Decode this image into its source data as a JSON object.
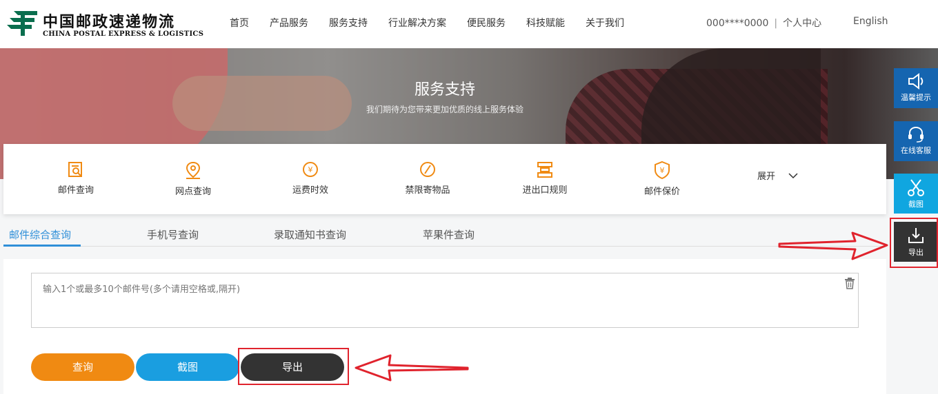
{
  "header": {
    "logo_cn": "中国邮政速递物流",
    "logo_en": "CHINA POSTAL EXPRESS & LOGISTICS",
    "nav": [
      "首页",
      "产品服务",
      "服务支持",
      "行业解决方案",
      "便民服务",
      "科技赋能",
      "关于我们"
    ],
    "account_phone": "000****0000",
    "account_sep": "|",
    "account_center": "个人中心",
    "language": "English"
  },
  "banner": {
    "title": "服务支持",
    "subtitle": "我们期待为您带来更加优质的线上服务体验"
  },
  "quick_services": {
    "items": [
      {
        "label": "邮件查询",
        "icon": "mail-search-icon"
      },
      {
        "label": "网点查询",
        "icon": "location-pin-icon"
      },
      {
        "label": "运费时效",
        "icon": "yuan-clock-icon"
      },
      {
        "label": "禁限寄物品",
        "icon": "forbidden-icon"
      },
      {
        "label": "进出口规则",
        "icon": "customs-rules-icon"
      },
      {
        "label": "邮件保价",
        "icon": "yuan-shield-icon"
      }
    ],
    "expand_label": "展开"
  },
  "tabs": [
    "邮件综合查询",
    "手机号查询",
    "录取通知书查询",
    "苹果件查询"
  ],
  "query": {
    "placeholder": "输入1个或最多10个邮件号(多个请用空格或,隔开)",
    "query_button": "查询",
    "screenshot_button": "截图",
    "export_button": "导出"
  },
  "side_toolbar": [
    {
      "label": "温馨提示",
      "icon": "speaker-icon"
    },
    {
      "label": "在线客服",
      "icon": "headset-icon"
    },
    {
      "label": "截图",
      "icon": "scissors-icon"
    },
    {
      "label": "导出",
      "icon": "download-icon"
    }
  ],
  "colors": {
    "brand_green": "#0a6e4e",
    "accent_blue": "#2f8fd8",
    "orange": "#f08a12",
    "cyan": "#1a9ee0",
    "dark": "#333333",
    "highlight_red": "#e0232d"
  }
}
